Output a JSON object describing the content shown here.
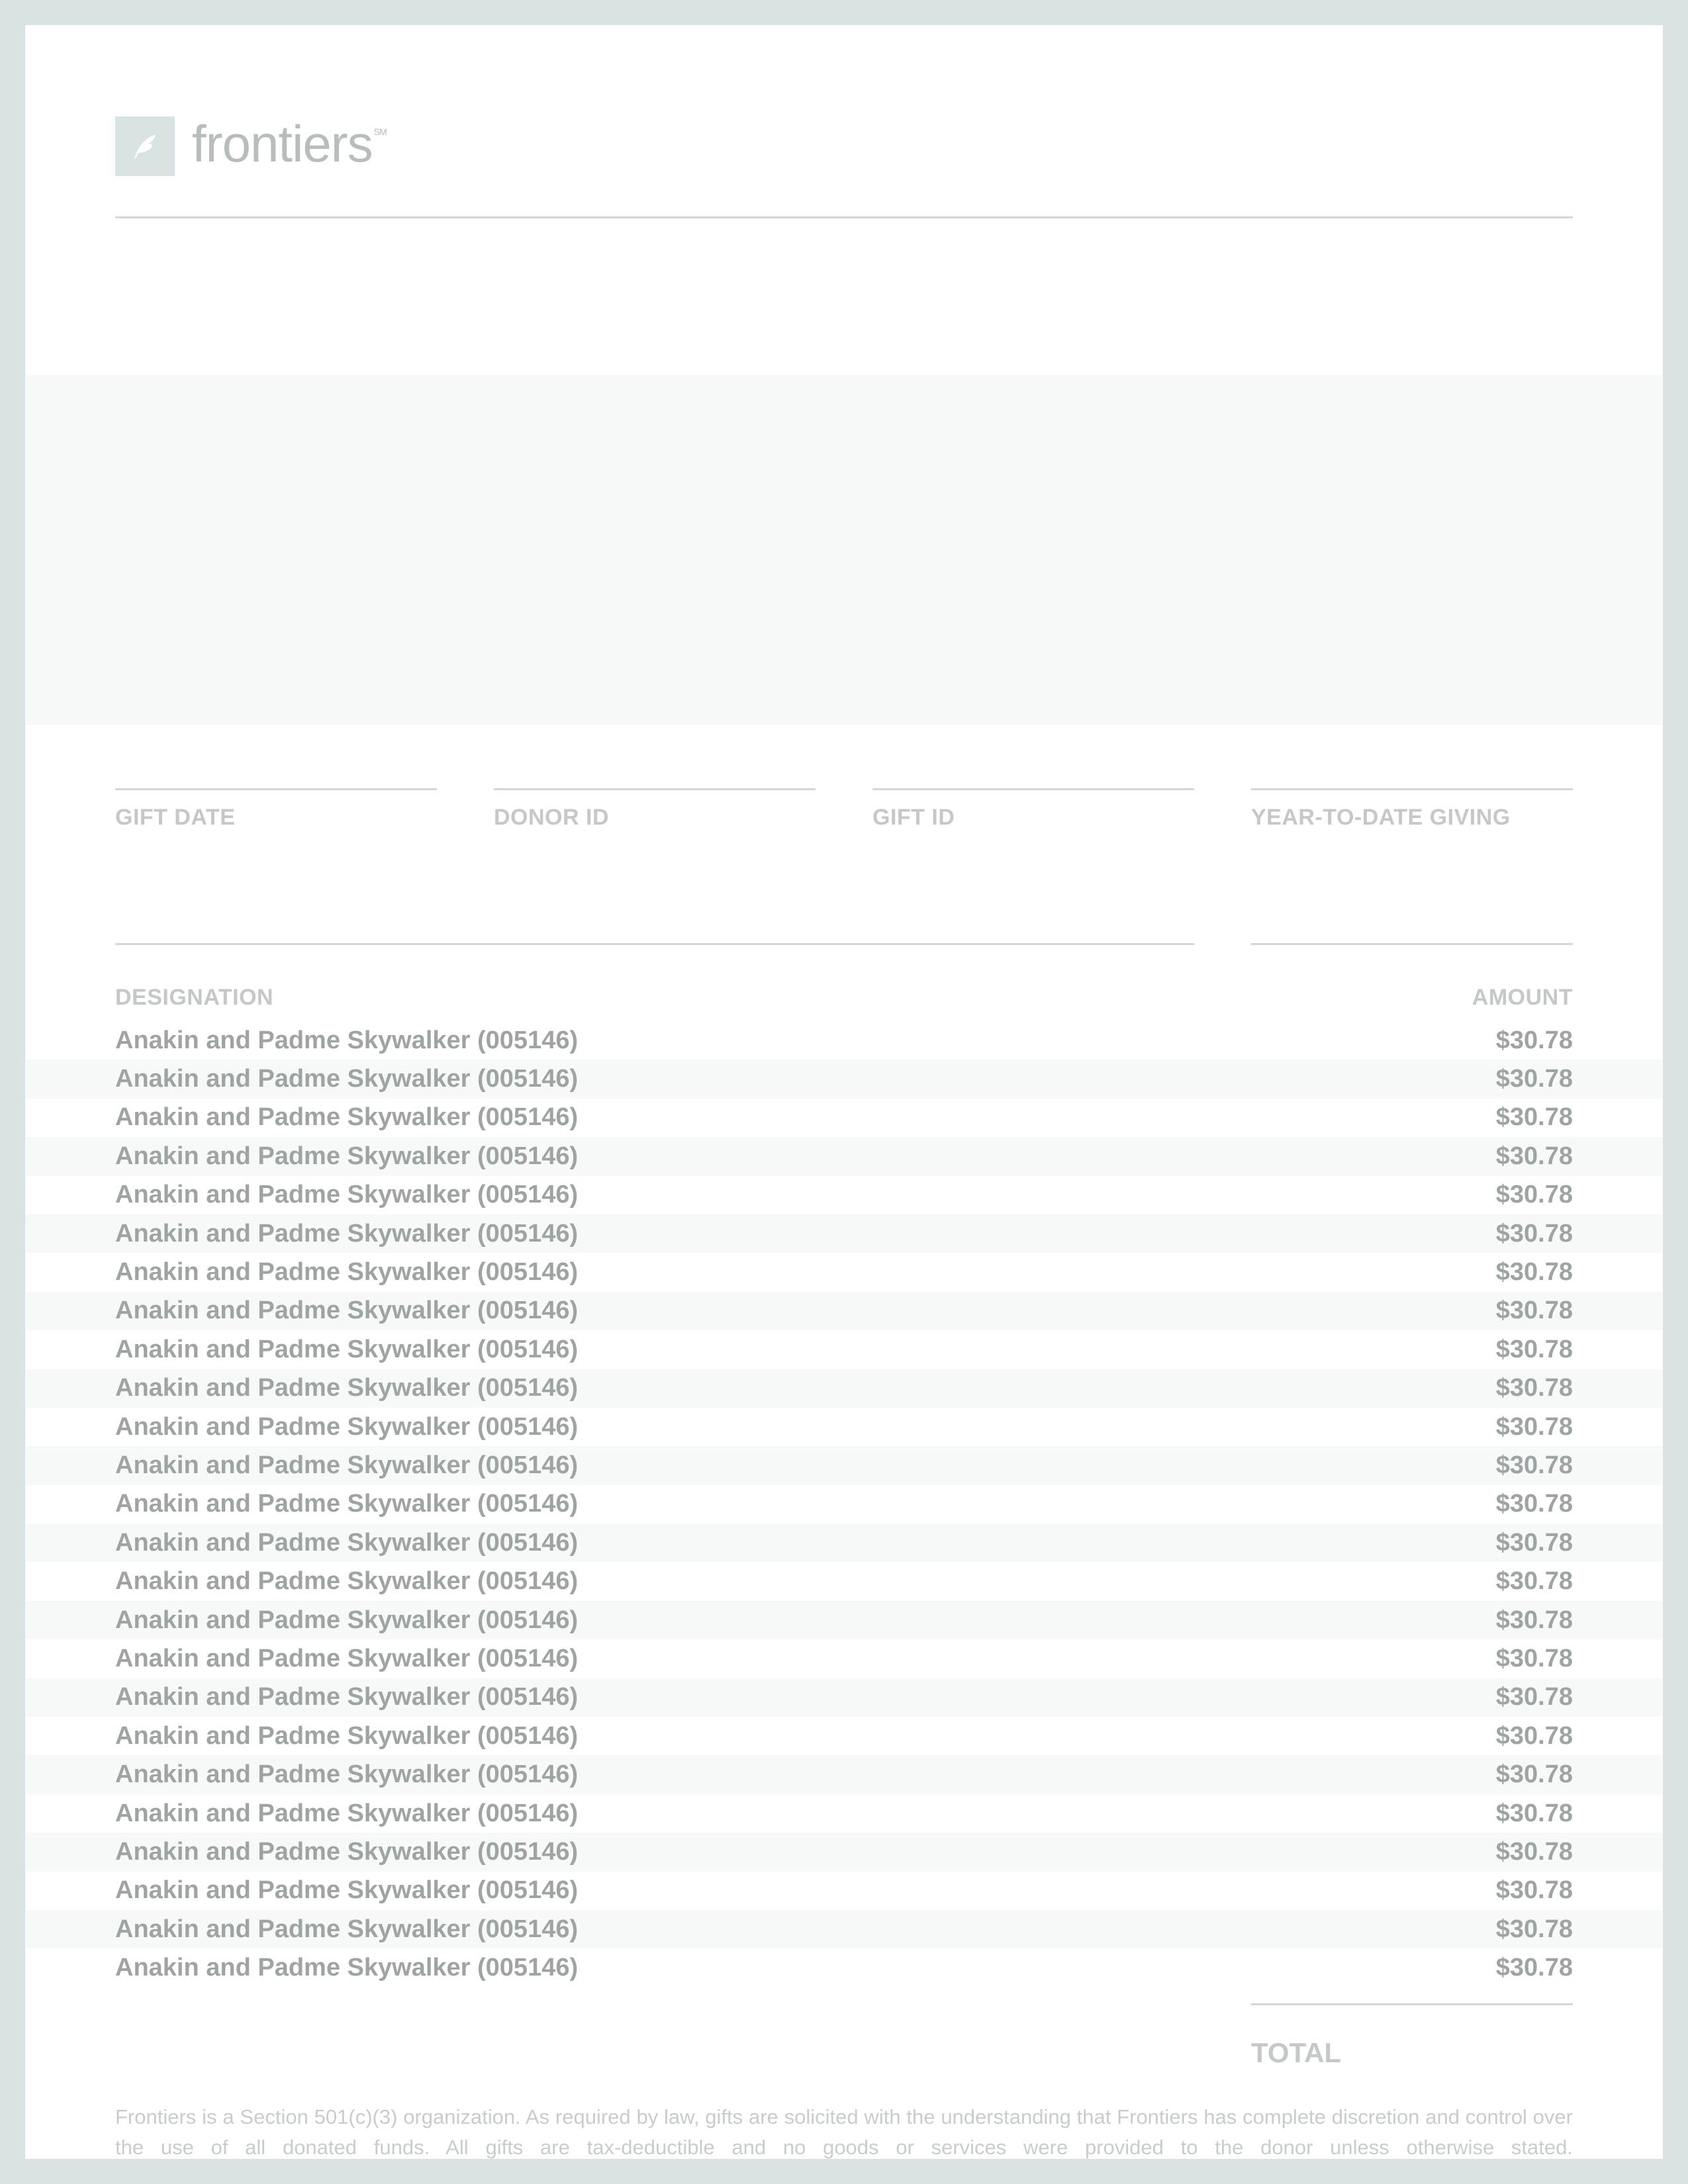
{
  "brand": {
    "logo_text": "frontiers",
    "logo_mark": "SM",
    "accent": "#d7e4e3"
  },
  "fields": [
    {
      "label": "GIFT DATE"
    },
    {
      "label": "DONOR ID"
    },
    {
      "label": "GIFT ID"
    },
    {
      "label": "YEAR-TO-DATE GIVING"
    }
  ],
  "table": {
    "designation_header": "DESIGNATION",
    "amount_header": "AMOUNT",
    "rows": [
      {
        "designation": "Anakin and Padme Skywalker (005146)",
        "amount": "$30.78"
      },
      {
        "designation": "Anakin and Padme Skywalker (005146)",
        "amount": "$30.78"
      },
      {
        "designation": "Anakin and Padme Skywalker (005146)",
        "amount": "$30.78"
      },
      {
        "designation": "Anakin and Padme Skywalker (005146)",
        "amount": "$30.78"
      },
      {
        "designation": "Anakin and Padme Skywalker (005146)",
        "amount": "$30.78"
      },
      {
        "designation": "Anakin and Padme Skywalker (005146)",
        "amount": "$30.78"
      },
      {
        "designation": "Anakin and Padme Skywalker (005146)",
        "amount": "$30.78"
      },
      {
        "designation": "Anakin and Padme Skywalker (005146)",
        "amount": "$30.78"
      },
      {
        "designation": "Anakin and Padme Skywalker (005146)",
        "amount": "$30.78"
      },
      {
        "designation": "Anakin and Padme Skywalker (005146)",
        "amount": "$30.78"
      },
      {
        "designation": "Anakin and Padme Skywalker (005146)",
        "amount": "$30.78"
      },
      {
        "designation": "Anakin and Padme Skywalker (005146)",
        "amount": "$30.78"
      },
      {
        "designation": "Anakin and Padme Skywalker (005146)",
        "amount": "$30.78"
      },
      {
        "designation": "Anakin and Padme Skywalker (005146)",
        "amount": "$30.78"
      },
      {
        "designation": "Anakin and Padme Skywalker (005146)",
        "amount": "$30.78"
      },
      {
        "designation": "Anakin and Padme Skywalker (005146)",
        "amount": "$30.78"
      },
      {
        "designation": "Anakin and Padme Skywalker (005146)",
        "amount": "$30.78"
      },
      {
        "designation": "Anakin and Padme Skywalker (005146)",
        "amount": "$30.78"
      },
      {
        "designation": "Anakin and Padme Skywalker (005146)",
        "amount": "$30.78"
      },
      {
        "designation": "Anakin and Padme Skywalker (005146)",
        "amount": "$30.78"
      },
      {
        "designation": "Anakin and Padme Skywalker (005146)",
        "amount": "$30.78"
      },
      {
        "designation": "Anakin and Padme Skywalker (005146)",
        "amount": "$30.78"
      },
      {
        "designation": "Anakin and Padme Skywalker (005146)",
        "amount": "$30.78"
      },
      {
        "designation": "Anakin and Padme Skywalker (005146)",
        "amount": "$30.78"
      },
      {
        "designation": "Anakin and Padme Skywalker (005146)",
        "amount": "$30.78"
      }
    ],
    "total_label": "TOTAL"
  },
  "footer": {
    "text": "Frontiers is a Section 501(c)(3) organization. As required by law, gifts are solicited with the understanding that Frontiers has complete discretion and control over the use of all donated funds. All gifts are tax-deductible and no goods or services were provided to the donor unless otherwise stated."
  }
}
